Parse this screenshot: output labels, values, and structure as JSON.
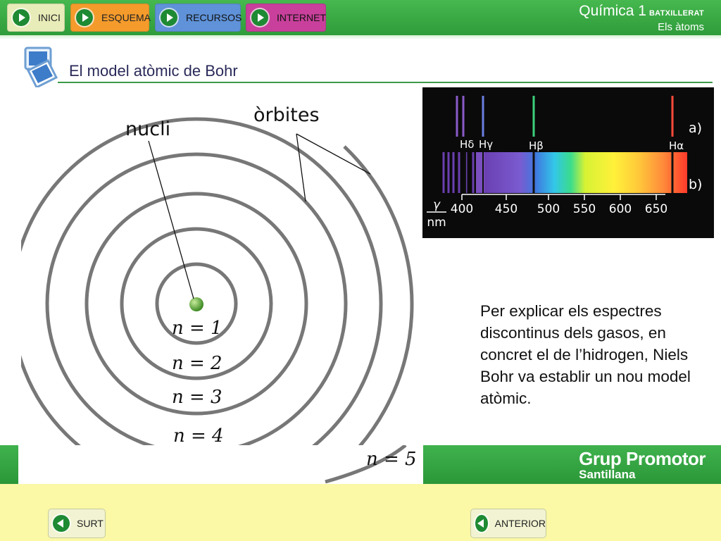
{
  "nav": {
    "inici": "INICI",
    "esquema": "ESQUEMA",
    "recursos": "RECURSOS",
    "internet": "INTERNET"
  },
  "course": {
    "title": "Química 1",
    "level": "BATXILLERAT",
    "unit": "Els àtoms"
  },
  "section": {
    "title": "El model atòmic de Bohr"
  },
  "diagram": {
    "nucleus_label": "nucli",
    "orbits_label": "òrbites",
    "levels": [
      "n = 1",
      "n = 2",
      "n = 3",
      "n = 4",
      "n = 5"
    ]
  },
  "spectrum": {
    "lines": [
      "Hδ",
      "Hγ",
      "Hβ",
      "Hα"
    ],
    "row_a": "a)",
    "row_b": "b)",
    "axis_symbol": "γ",
    "axis_unit": "nm",
    "ticks": [
      "400",
      "450",
      "500",
      "550",
      "600",
      "650"
    ]
  },
  "body": {
    "text": "Per explicar els espectres discontinus dels gasos, en concret el de l’hidrogen, Niels Bohr va establir un nou model atòmic."
  },
  "brand": {
    "line1": "Grup Promotor",
    "line2": "Santillana"
  },
  "footer": {
    "surt": "SURT",
    "anterior": "ANTERIOR"
  },
  "colors": {
    "green": "#2f9c3a",
    "orbit": "#777777",
    "nucleus": "#5aa83a"
  }
}
